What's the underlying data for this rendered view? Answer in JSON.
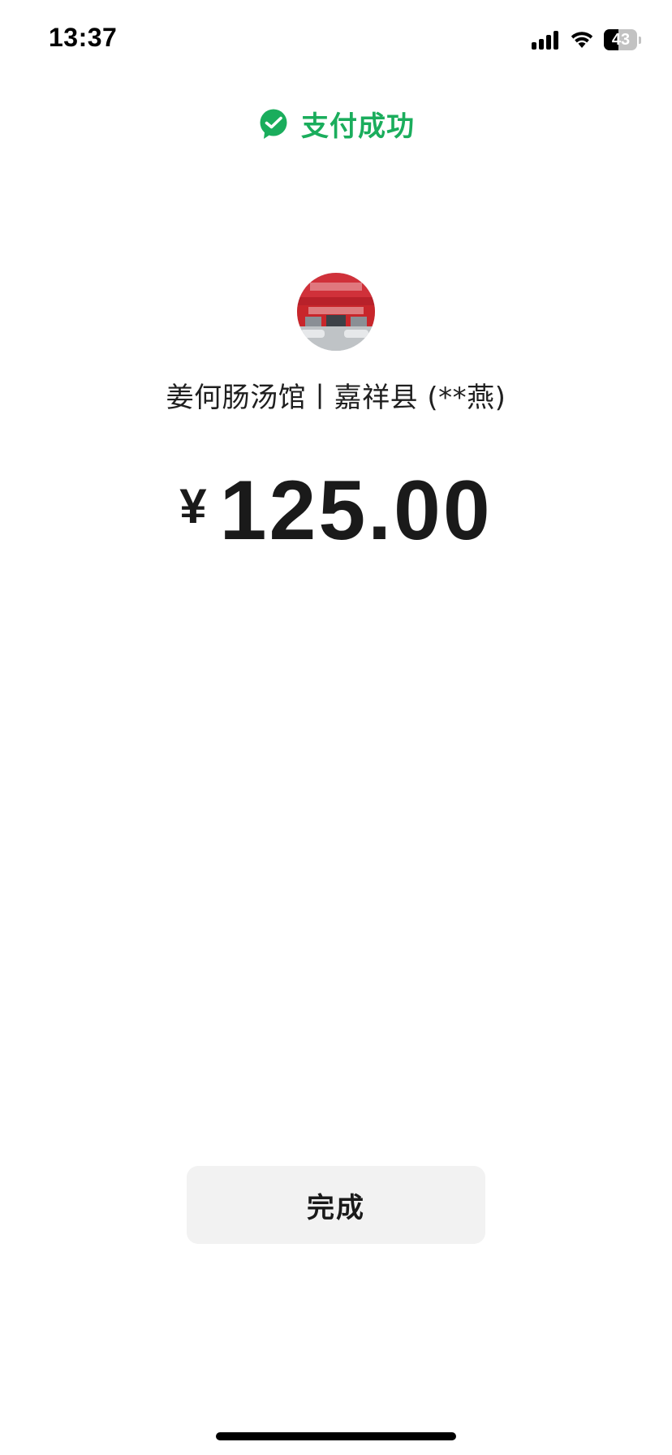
{
  "status_bar": {
    "time": "13:37",
    "battery_level": "43",
    "battery_fraction": 0.43,
    "icons": [
      "signal-icon",
      "wifi-icon",
      "battery-icon"
    ]
  },
  "header": {
    "icon": "wechat-pay-icon",
    "title": "支付成功",
    "accent_color": "#1aad5c"
  },
  "merchant": {
    "avatar": "merchant-storefront-avatar",
    "name": "姜何肠汤馆丨嘉祥县 (**燕)"
  },
  "payment": {
    "currency_symbol": "¥",
    "amount": "125.00"
  },
  "actions": {
    "done_label": "完成"
  },
  "colors": {
    "background": "#ffffff",
    "text": "#1a1a1a",
    "button_background": "#f2f2f2",
    "storefront_red": "#c8262b"
  }
}
